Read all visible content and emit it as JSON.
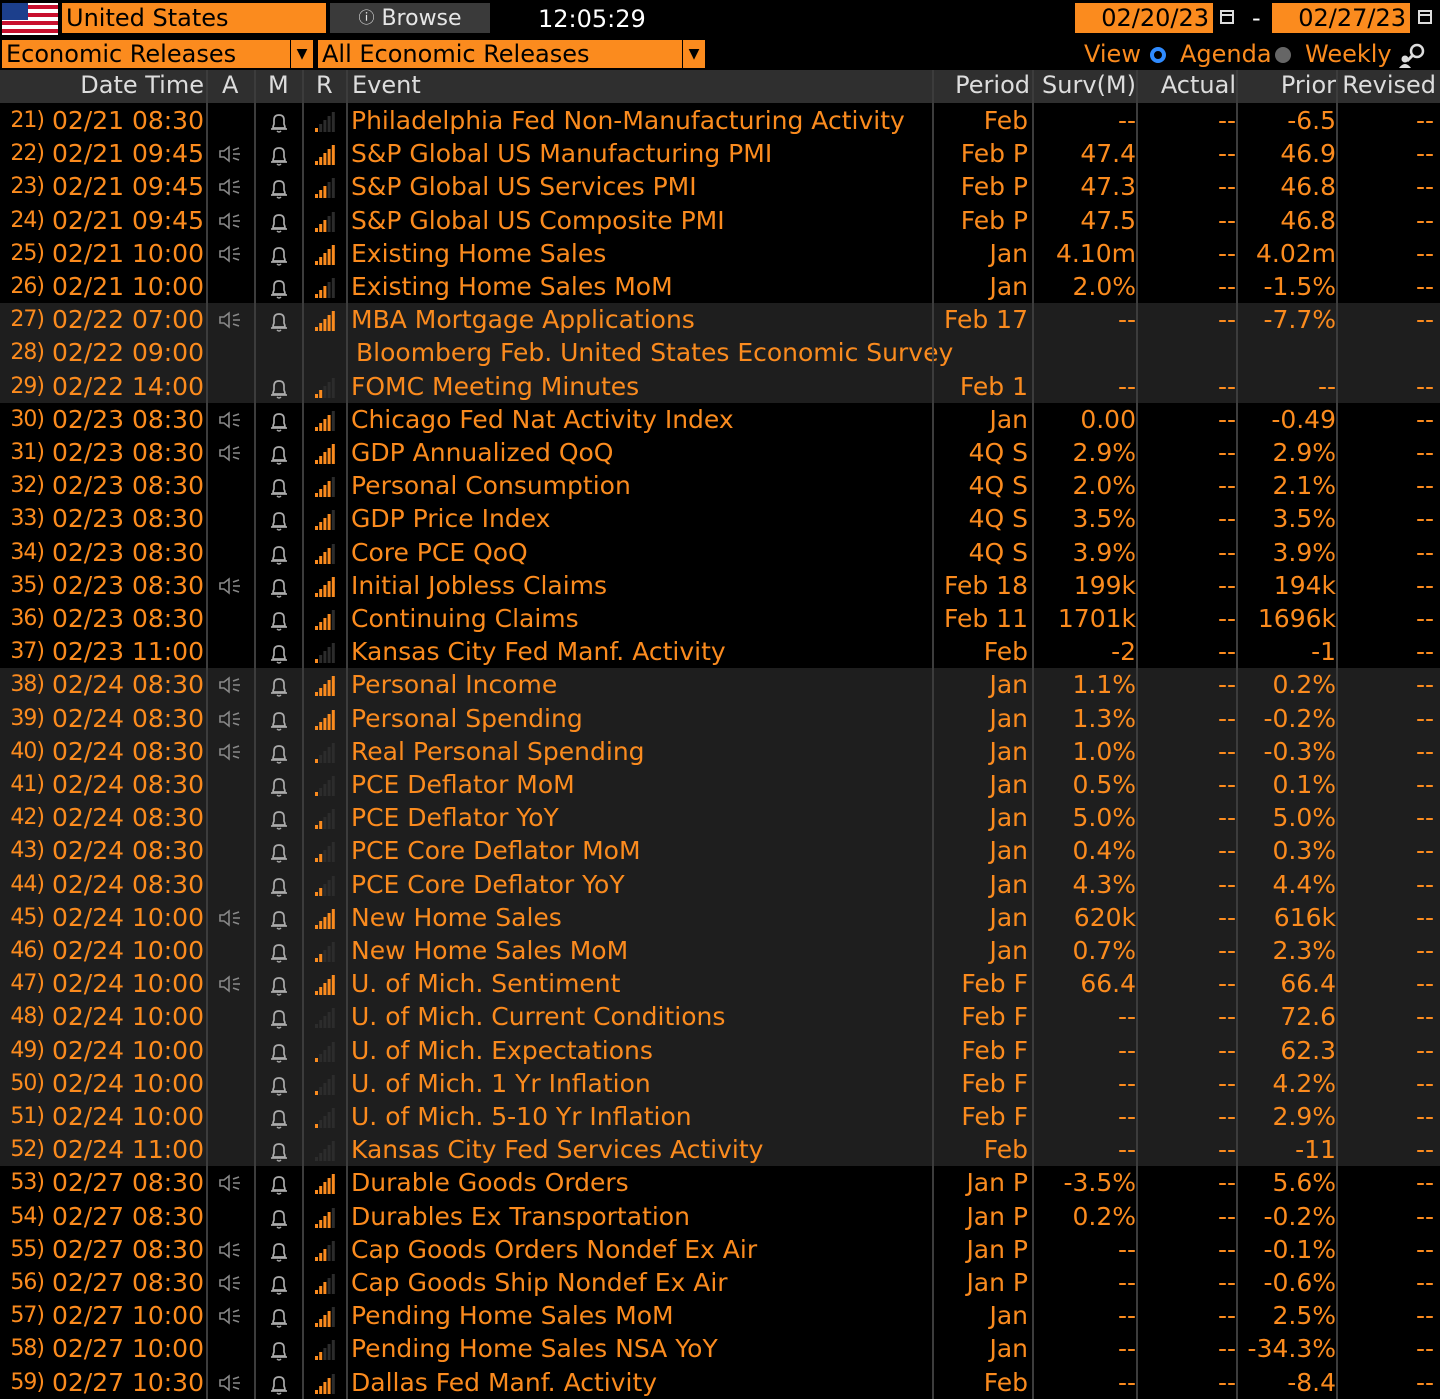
{
  "toolbar": {
    "country": "United States",
    "browse_label": "Browse",
    "browse_icon": "info-icon",
    "time": "12:05:29",
    "start_date": "02/20/23",
    "date_separator": "-",
    "end_date": "02/27/23",
    "category": "Economic Releases",
    "filter": "All Economic Releases",
    "view_label": "View",
    "view_options": [
      "Agenda",
      "Weekly"
    ],
    "view_selected": "Agenda"
  },
  "columns": [
    "Date Time",
    "A",
    "M",
    "R",
    "Event",
    "Period",
    "Surv(M)",
    "Actual",
    "Prior",
    "Revised"
  ],
  "colors": {
    "accent": "#fb8b1e",
    "header_bg": "#2f2f2f",
    "shaded_row_bg": "#1e1e1e",
    "link_blue": "#2f8bff"
  },
  "rows": [
    {
      "n": "21)",
      "dt": "02/21 08:30",
      "a": false,
      "m": true,
      "r": 1,
      "event": "Philadelphia Fed Non-Manufacturing Activity",
      "period": "Feb",
      "surv": "--",
      "actual": "--",
      "prior": "-6.5",
      "revised": "--",
      "shade": false
    },
    {
      "n": "22)",
      "dt": "02/21 09:45",
      "a": true,
      "m": true,
      "r": 5,
      "event": "S&P Global US Manufacturing PMI",
      "period": "Feb P",
      "surv": "47.4",
      "actual": "--",
      "prior": "46.9",
      "revised": "--",
      "shade": false
    },
    {
      "n": "23)",
      "dt": "02/21 09:45",
      "a": true,
      "m": true,
      "r": 3,
      "event": "S&P Global US Services PMI",
      "period": "Feb P",
      "surv": "47.3",
      "actual": "--",
      "prior": "46.8",
      "revised": "--",
      "shade": false
    },
    {
      "n": "24)",
      "dt": "02/21 09:45",
      "a": true,
      "m": true,
      "r": 3,
      "event": "S&P Global US Composite PMI",
      "period": "Feb P",
      "surv": "47.5",
      "actual": "--",
      "prior": "46.8",
      "revised": "--",
      "shade": false
    },
    {
      "n": "25)",
      "dt": "02/21 10:00",
      "a": true,
      "m": true,
      "r": 5,
      "event": "Existing Home Sales",
      "period": "Jan",
      "surv": "4.10m",
      "actual": "--",
      "prior": "4.02m",
      "revised": "--",
      "shade": false
    },
    {
      "n": "26)",
      "dt": "02/21 10:00",
      "a": false,
      "m": true,
      "r": 3,
      "event": "Existing Home Sales MoM",
      "period": "Jan",
      "surv": "2.0%",
      "actual": "--",
      "prior": "-1.5%",
      "revised": "--",
      "shade": false
    },
    {
      "n": "27)",
      "dt": "02/22 07:00",
      "a": true,
      "m": true,
      "r": 5,
      "event": "MBA Mortgage Applications",
      "period": "Feb 17",
      "surv": "--",
      "actual": "--",
      "prior": "-7.7%",
      "revised": "--",
      "shade": true
    },
    {
      "n": "28)",
      "dt": "02/22 09:00",
      "a": false,
      "m": false,
      "r": 0,
      "event": "Bloomberg Feb. United States Economic Survey",
      "period": "",
      "surv": "",
      "actual": "",
      "prior": "",
      "revised": "",
      "shade": true,
      "span": true
    },
    {
      "n": "29)",
      "dt": "02/22 14:00",
      "a": false,
      "m": true,
      "r": 2,
      "event": "FOMC Meeting Minutes",
      "period": "Feb 1",
      "surv": "--",
      "actual": "--",
      "prior": "--",
      "revised": "--",
      "shade": true
    },
    {
      "n": "30)",
      "dt": "02/23 08:30",
      "a": true,
      "m": true,
      "r": 4,
      "event": "Chicago Fed Nat Activity Index",
      "period": "Jan",
      "surv": "0.00",
      "actual": "--",
      "prior": "-0.49",
      "revised": "--",
      "shade": false
    },
    {
      "n": "31)",
      "dt": "02/23 08:30",
      "a": true,
      "m": true,
      "r": 5,
      "event": "GDP Annualized QoQ",
      "period": "4Q S",
      "surv": "2.9%",
      "actual": "--",
      "prior": "2.9%",
      "revised": "--",
      "shade": false
    },
    {
      "n": "32)",
      "dt": "02/23 08:30",
      "a": false,
      "m": true,
      "r": 4,
      "event": "Personal Consumption",
      "period": "4Q S",
      "surv": "2.0%",
      "actual": "--",
      "prior": "2.1%",
      "revised": "--",
      "shade": false
    },
    {
      "n": "33)",
      "dt": "02/23 08:30",
      "a": false,
      "m": true,
      "r": 4,
      "event": "GDP Price Index",
      "period": "4Q S",
      "surv": "3.5%",
      "actual": "--",
      "prior": "3.5%",
      "revised": "--",
      "shade": false
    },
    {
      "n": "34)",
      "dt": "02/23 08:30",
      "a": false,
      "m": true,
      "r": 4,
      "event": "Core PCE QoQ",
      "period": "4Q S",
      "surv": "3.9%",
      "actual": "--",
      "prior": "3.9%",
      "revised": "--",
      "shade": false
    },
    {
      "n": "35)",
      "dt": "02/23 08:30",
      "a": true,
      "m": true,
      "r": 5,
      "event": "Initial Jobless Claims",
      "period": "Feb 18",
      "surv": "199k",
      "actual": "--",
      "prior": "194k",
      "revised": "--",
      "shade": false
    },
    {
      "n": "36)",
      "dt": "02/23 08:30",
      "a": false,
      "m": true,
      "r": 4,
      "event": "Continuing Claims",
      "period": "Feb 11",
      "surv": "1701k",
      "actual": "--",
      "prior": "1696k",
      "revised": "--",
      "shade": false
    },
    {
      "n": "37)",
      "dt": "02/23 11:00",
      "a": false,
      "m": true,
      "r": 1,
      "event": "Kansas City Fed Manf. Activity",
      "period": "Feb",
      "surv": "-2",
      "actual": "--",
      "prior": "-1",
      "revised": "--",
      "shade": false
    },
    {
      "n": "38)",
      "dt": "02/24 08:30",
      "a": true,
      "m": true,
      "r": 5,
      "event": "Personal Income",
      "period": "Jan",
      "surv": "1.1%",
      "actual": "--",
      "prior": "0.2%",
      "revised": "--",
      "shade": true
    },
    {
      "n": "39)",
      "dt": "02/24 08:30",
      "a": true,
      "m": true,
      "r": 5,
      "event": "Personal Spending",
      "period": "Jan",
      "surv": "1.3%",
      "actual": "--",
      "prior": "-0.2%",
      "revised": "--",
      "shade": true
    },
    {
      "n": "40)",
      "dt": "02/24 08:30",
      "a": true,
      "m": true,
      "r": 1,
      "event": "Real Personal Spending",
      "period": "Jan",
      "surv": "1.0%",
      "actual": "--",
      "prior": "-0.3%",
      "revised": "--",
      "shade": true
    },
    {
      "n": "41)",
      "dt": "02/24 08:30",
      "a": false,
      "m": true,
      "r": 1,
      "event": "PCE Deflator MoM",
      "period": "Jan",
      "surv": "0.5%",
      "actual": "--",
      "prior": "0.1%",
      "revised": "--",
      "shade": true
    },
    {
      "n": "42)",
      "dt": "02/24 08:30",
      "a": false,
      "m": true,
      "r": 2,
      "event": "PCE Deflator YoY",
      "period": "Jan",
      "surv": "5.0%",
      "actual": "--",
      "prior": "5.0%",
      "revised": "--",
      "shade": true
    },
    {
      "n": "43)",
      "dt": "02/24 08:30",
      "a": false,
      "m": true,
      "r": 2,
      "event": "PCE Core Deflator MoM",
      "period": "Jan",
      "surv": "0.4%",
      "actual": "--",
      "prior": "0.3%",
      "revised": "--",
      "shade": true
    },
    {
      "n": "44)",
      "dt": "02/24 08:30",
      "a": false,
      "m": true,
      "r": 2,
      "event": "PCE Core Deflator YoY",
      "period": "Jan",
      "surv": "4.3%",
      "actual": "--",
      "prior": "4.4%",
      "revised": "--",
      "shade": true
    },
    {
      "n": "45)",
      "dt": "02/24 10:00",
      "a": true,
      "m": true,
      "r": 5,
      "event": "New Home Sales",
      "period": "Jan",
      "surv": "620k",
      "actual": "--",
      "prior": "616k",
      "revised": "--",
      "shade": true
    },
    {
      "n": "46)",
      "dt": "02/24 10:00",
      "a": false,
      "m": true,
      "r": 2,
      "event": "New Home Sales MoM",
      "period": "Jan",
      "surv": "0.7%",
      "actual": "--",
      "prior": "2.3%",
      "revised": "--",
      "shade": true
    },
    {
      "n": "47)",
      "dt": "02/24 10:00",
      "a": true,
      "m": true,
      "r": 5,
      "event": "U. of Mich. Sentiment",
      "period": "Feb F",
      "surv": "66.4",
      "actual": "--",
      "prior": "66.4",
      "revised": "--",
      "shade": true
    },
    {
      "n": "48)",
      "dt": "02/24 10:00",
      "a": false,
      "m": true,
      "r": 0,
      "event": "U. of Mich. Current Conditions",
      "period": "Feb F",
      "surv": "--",
      "actual": "--",
      "prior": "72.6",
      "revised": "--",
      "shade": true
    },
    {
      "n": "49)",
      "dt": "02/24 10:00",
      "a": false,
      "m": true,
      "r": 1,
      "event": "U. of Mich. Expectations",
      "period": "Feb F",
      "surv": "--",
      "actual": "--",
      "prior": "62.3",
      "revised": "--",
      "shade": true
    },
    {
      "n": "50)",
      "dt": "02/24 10:00",
      "a": false,
      "m": true,
      "r": 1,
      "event": "U. of Mich. 1 Yr Inflation",
      "period": "Feb F",
      "surv": "--",
      "actual": "--",
      "prior": "4.2%",
      "revised": "--",
      "shade": true
    },
    {
      "n": "51)",
      "dt": "02/24 10:00",
      "a": false,
      "m": true,
      "r": 1,
      "event": "U. of Mich. 5-10 Yr Inflation",
      "period": "Feb F",
      "surv": "--",
      "actual": "--",
      "prior": "2.9%",
      "revised": "--",
      "shade": true
    },
    {
      "n": "52)",
      "dt": "02/24 11:00",
      "a": false,
      "m": true,
      "r": 0,
      "event": "Kansas City Fed Services Activity",
      "period": "Feb",
      "surv": "--",
      "actual": "--",
      "prior": "-11",
      "revised": "--",
      "shade": true
    },
    {
      "n": "53)",
      "dt": "02/27 08:30",
      "a": true,
      "m": true,
      "r": 5,
      "event": "Durable Goods Orders",
      "period": "Jan P",
      "surv": "-3.5%",
      "actual": "--",
      "prior": "5.6%",
      "revised": "--",
      "shade": false
    },
    {
      "n": "54)",
      "dt": "02/27 08:30",
      "a": false,
      "m": true,
      "r": 4,
      "event": "Durables Ex Transportation",
      "period": "Jan P",
      "surv": "0.2%",
      "actual": "--",
      "prior": "-0.2%",
      "revised": "--",
      "shade": false
    },
    {
      "n": "55)",
      "dt": "02/27 08:30",
      "a": true,
      "m": true,
      "r": 3,
      "event": "Cap Goods Orders Nondef Ex Air",
      "period": "Jan P",
      "surv": "--",
      "actual": "--",
      "prior": "-0.1%",
      "revised": "--",
      "shade": false
    },
    {
      "n": "56)",
      "dt": "02/27 08:30",
      "a": true,
      "m": true,
      "r": 3,
      "event": "Cap Goods Ship Nondef Ex Air",
      "period": "Jan P",
      "surv": "--",
      "actual": "--",
      "prior": "-0.6%",
      "revised": "--",
      "shade": false
    },
    {
      "n": "57)",
      "dt": "02/27 10:00",
      "a": true,
      "m": true,
      "r": 4,
      "event": "Pending Home Sales MoM",
      "period": "Jan",
      "surv": "--",
      "actual": "--",
      "prior": "2.5%",
      "revised": "--",
      "shade": false
    },
    {
      "n": "58)",
      "dt": "02/27 10:00",
      "a": false,
      "m": true,
      "r": 2,
      "event": "Pending Home Sales NSA YoY",
      "period": "Jan",
      "surv": "--",
      "actual": "--",
      "prior": "-34.3%",
      "revised": "--",
      "shade": false
    },
    {
      "n": "59)",
      "dt": "02/27 10:30",
      "a": true,
      "m": true,
      "r": 4,
      "event": "Dallas Fed Manf. Activity",
      "period": "Feb",
      "surv": "--",
      "actual": "--",
      "prior": "-8.4",
      "revised": "--",
      "shade": false
    }
  ]
}
